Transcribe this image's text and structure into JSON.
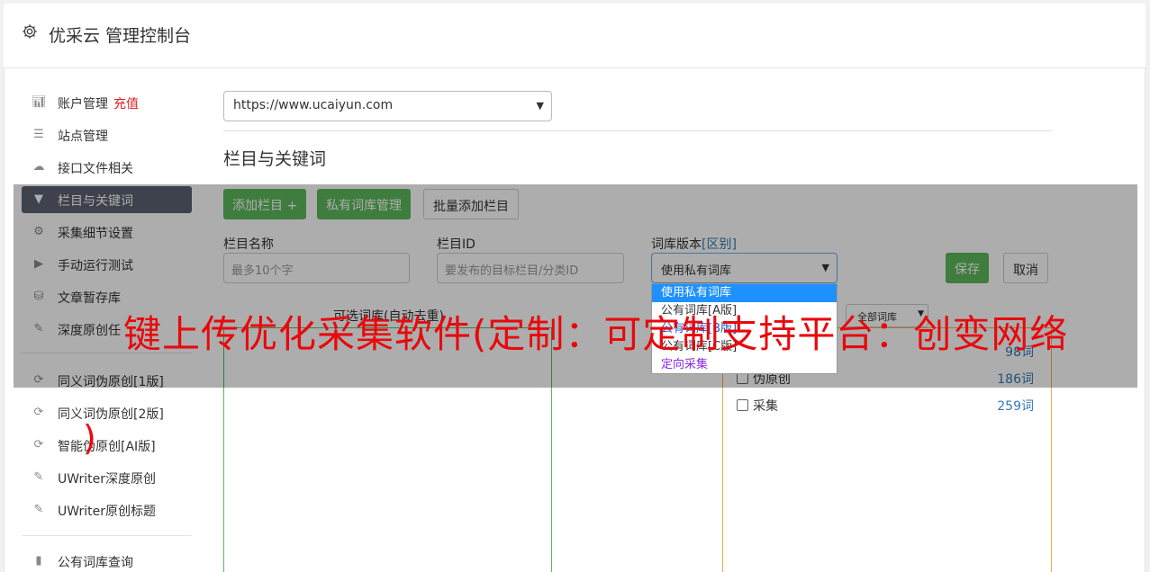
{
  "header": {
    "title": "优采云 管理控制台"
  },
  "sidebar": {
    "items": [
      {
        "label": "账户管理",
        "extra": "充值",
        "icon": "bar-chart-icon"
      },
      {
        "label": "站点管理",
        "icon": "server-icon"
      },
      {
        "label": "接口文件相关",
        "icon": "cloud-upload-icon"
      },
      {
        "label": "栏目与关键词",
        "icon": "filter-icon",
        "active": true
      },
      {
        "label": "采集细节设置",
        "icon": "gears-icon"
      },
      {
        "label": "手动运行测试",
        "icon": "play-circle-icon"
      },
      {
        "label": "文章暂存库",
        "icon": "database-icon"
      },
      {
        "label": "深度原创任",
        "icon": "edit-icon"
      },
      {
        "label": "同义词伪原创[1版]",
        "icon": "refresh-icon"
      },
      {
        "label": "同义词伪原创[2版]",
        "icon": "refresh-icon"
      },
      {
        "label": "智能伪原创[AI版]",
        "icon": "refresh-icon"
      },
      {
        "label": "UWriter深度原创",
        "icon": "edit-icon"
      },
      {
        "label": "UWriter原创标题",
        "icon": "edit-icon"
      },
      {
        "label": "公有词库查询",
        "icon": "book-icon"
      }
    ]
  },
  "site_select": {
    "value": "https://www.ucaiyun.com"
  },
  "section": {
    "title": "栏目与关键词"
  },
  "toolbar": {
    "add_column": "添加栏目 +",
    "private_lib": "私有词库管理",
    "batch_add": "批量添加栏目"
  },
  "form": {
    "name_label": "栏目名称",
    "name_placeholder": "最多10个字",
    "id_label": "栏目ID",
    "id_placeholder": "要发布的目标栏目/分类ID",
    "version_label": "词库版本",
    "version_diff": "[区别]",
    "version_value": "使用私有词库",
    "save": "保存",
    "cancel": "取消"
  },
  "version_options": [
    {
      "label": "使用私有词库",
      "style": "sel"
    },
    {
      "label": "公有词库[A版]",
      "style": ""
    },
    {
      "label": "公有词库[B版]",
      "style": "blue"
    },
    {
      "label": "公有词库[C版]",
      "style": ""
    },
    {
      "label": "定向采集",
      "style": "purple"
    }
  ],
  "left_box": {
    "title": "可选词库(自动去重)"
  },
  "right_box": {
    "filter": "全部词库",
    "rows": [
      {
        "name": "",
        "count": "98词"
      },
      {
        "name": "伪原创",
        "count": "186词"
      },
      {
        "name": "采集",
        "count": "259词"
      }
    ]
  },
  "watermark": {
    "line1": "键上传优化采集软件(定制：可定制支持平台：创变网络",
    "line2": ")"
  },
  "colors": {
    "primary_green": "#5cb85c",
    "accent_orange": "#f0ad4e",
    "link_blue": "#337ab7",
    "danger_red": "#e02020"
  }
}
